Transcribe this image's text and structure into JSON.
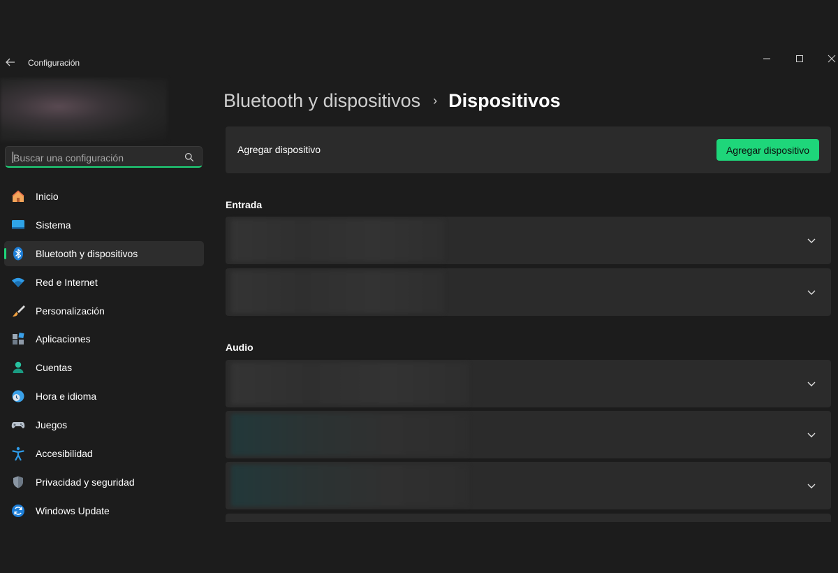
{
  "window": {
    "title": "Configuración",
    "controls": [
      "minimize",
      "maximize",
      "close"
    ]
  },
  "search": {
    "placeholder": "Buscar una configuración",
    "value": ""
  },
  "sidebar": {
    "items": [
      {
        "label": "Inicio",
        "icon": "home-icon",
        "active": false
      },
      {
        "label": "Sistema",
        "icon": "system-icon",
        "active": false
      },
      {
        "label": "Bluetooth y dispositivos",
        "icon": "bluetooth-icon",
        "active": true
      },
      {
        "label": "Red e Internet",
        "icon": "wifi-icon",
        "active": false
      },
      {
        "label": "Personalización",
        "icon": "brush-icon",
        "active": false
      },
      {
        "label": "Aplicaciones",
        "icon": "apps-icon",
        "active": false
      },
      {
        "label": "Cuentas",
        "icon": "account-icon",
        "active": false
      },
      {
        "label": "Hora e idioma",
        "icon": "time-language-icon",
        "active": false
      },
      {
        "label": "Juegos",
        "icon": "gamepad-icon",
        "active": false
      },
      {
        "label": "Accesibilidad",
        "icon": "accessibility-icon",
        "active": false
      },
      {
        "label": "Privacidad y seguridad",
        "icon": "shield-icon",
        "active": false
      },
      {
        "label": "Windows Update",
        "icon": "update-icon",
        "active": false
      }
    ]
  },
  "header": {
    "parent": "Bluetooth y dispositivos",
    "separator": "›",
    "current": "Dispositivos"
  },
  "add_device": {
    "label": "Agregar dispositivo",
    "button": "Agregar dispositivo"
  },
  "sections": {
    "input": {
      "title": "Entrada"
    },
    "audio": {
      "title": "Audio"
    }
  },
  "colors": {
    "accent": "#1ed67a",
    "background": "#1c1c1c",
    "card": "#2b2b2b"
  }
}
